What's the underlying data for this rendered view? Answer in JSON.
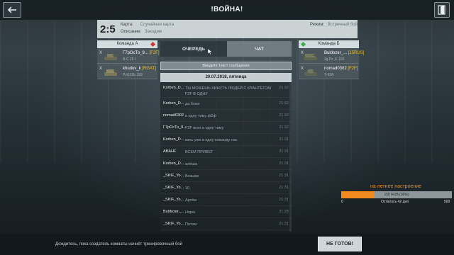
{
  "header": {
    "title": "!ВОЙНА!",
    "back_icon": "arrow-left-icon",
    "exit_icon": "exit-door-icon"
  },
  "room_info": {
    "timer": "2:5",
    "map_label": "Карта:",
    "map_value": "Случайная карта",
    "description_label": "Описание:",
    "description_value": "Заходим",
    "mode_label": "Режим:",
    "mode_value": "Встречный бой"
  },
  "team_a": {
    "title": "Команда А",
    "marker_color": "#d9302c",
    "players": [
      {
        "status": "X",
        "name": "Г7рОсТо_9...",
        "clan": "[F2F]",
        "tank": "B-C 25 t"
      },
      {
        "status": "X",
        "name": "khudov_k",
        "clan": "[RGAT]",
        "tank": "PzG15b 183"
      }
    ]
  },
  "team_b": {
    "title": "Команда Б",
    "marker_color": "#3fae4a",
    "players": [
      {
        "status": "X",
        "name": "Buldozer_...",
        "clan": "[15RUS]",
        "tank": "Jg.Pz. E 100"
      },
      {
        "status": "X",
        "name": "nomad0302",
        "clan": "[F2F]",
        "tank": "T-62A"
      }
    ]
  },
  "tabs": {
    "queue": "ОЧЕРЕДЬ",
    "chat": "ЧАТ"
  },
  "chat": {
    "input_placeholder": "Введите текст сообщения",
    "date": "20.07.2018, пятница",
    "messages": [
      {
        "author": "Korben_D...",
        "text": "ТЫ МОЖЕШЬ КИНУТЬ ЛЮДЕЙ С КЛАНТЕГОМ F2F В ОДНУ",
        "time": "21:32"
      },
      {
        "author": "Korben_D...",
        "text": "да боже",
        "time": "21:32"
      },
      {
        "author": "nomad0302",
        "text": "в одну тиму ф2ф",
        "time": "21:32"
      },
      {
        "author": "Г7рОсТо_9...",
        "text": "F2F всех в одну тиму",
        "time": "21:32"
      },
      {
        "author": "Korben_D...",
        "text": "кинь уже в одну команду нас",
        "time": "21:31"
      },
      {
        "author": "ABAHF",
        "text": "ВСЕМ ПРИВЕТ",
        "time": "21:31"
      },
      {
        "author": "Korben_D...",
        "text": "алёша",
        "time": "21:31"
      },
      {
        "author": "_SKIF_Yo...",
        "text": "Возьми",
        "time": "21:31"
      },
      {
        "author": "_SKIF_Yo...",
        "text": "10",
        "time": "21:31"
      },
      {
        "author": "_SKIF_Yo...",
        "text": "Артём",
        "time": "21:31"
      },
      {
        "author": "Buldozer_...",
        "text": "Норм",
        "time": "21:28"
      },
      {
        "author": "_SKIF_Yo...",
        "text": "Потом",
        "time": "21:31"
      }
    ]
  },
  "promo": {
    "title": "на летнее настроение",
    "progress_label": "150 RUB (30%)",
    "progress_fraction": 0.3,
    "progress_color": "#f08a1e",
    "min": "0",
    "remaining": "Осталось 42 дня",
    "max": "500"
  },
  "footer": {
    "waiting_text": "Дождитесь, пока создатель комнаты начнёт тренировочный бой",
    "ready_button": "НЕ ГОТОВ!"
  }
}
